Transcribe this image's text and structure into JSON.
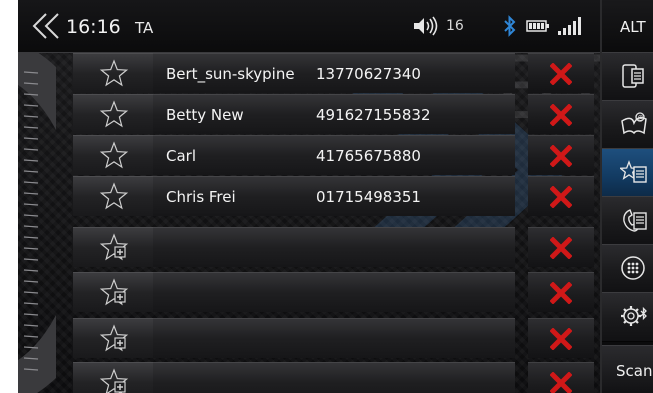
{
  "status_bar": {
    "time": "16:16",
    "traffic_announcement": "TA",
    "volume": "16",
    "volume_icon": "speaker-icon",
    "bluetooth_icon": "bluetooth-icon",
    "battery_icon": "battery-icon",
    "signal_icon": "signal-icon"
  },
  "side_menu": {
    "alt_label": "ALT",
    "items": [
      {
        "icon": "phone-contacts-icon",
        "active": false
      },
      {
        "icon": "phonebook-icon",
        "active": false
      },
      {
        "icon": "favorites-list-icon",
        "active": true
      },
      {
        "icon": "call-list-icon",
        "active": false
      },
      {
        "icon": "keypad-icon",
        "active": false
      },
      {
        "icon": "bluetooth-settings-icon",
        "active": false
      }
    ],
    "scan_label": "Scan"
  },
  "favorites": [
    {
      "name": "Bert_sun-skypine",
      "number": "13770627340",
      "assigned": true
    },
    {
      "name": "Betty New",
      "number": "491627155832",
      "assigned": true
    },
    {
      "name": "Carl",
      "number": "41765675880",
      "assigned": true
    },
    {
      "name": "Chris Frei",
      "number": "01715498351",
      "assigned": true
    },
    {
      "name": "",
      "number": "",
      "assigned": false
    },
    {
      "name": "",
      "number": "",
      "assigned": false
    },
    {
      "name": "",
      "number": "",
      "assigned": false
    },
    {
      "name": "",
      "number": "",
      "assigned": false
    }
  ],
  "watermark_text": "BT",
  "colors": {
    "accent_blue": "#1e4f7e",
    "delete_red": "#d01818",
    "bluetooth_blue": "#2f86d6"
  }
}
